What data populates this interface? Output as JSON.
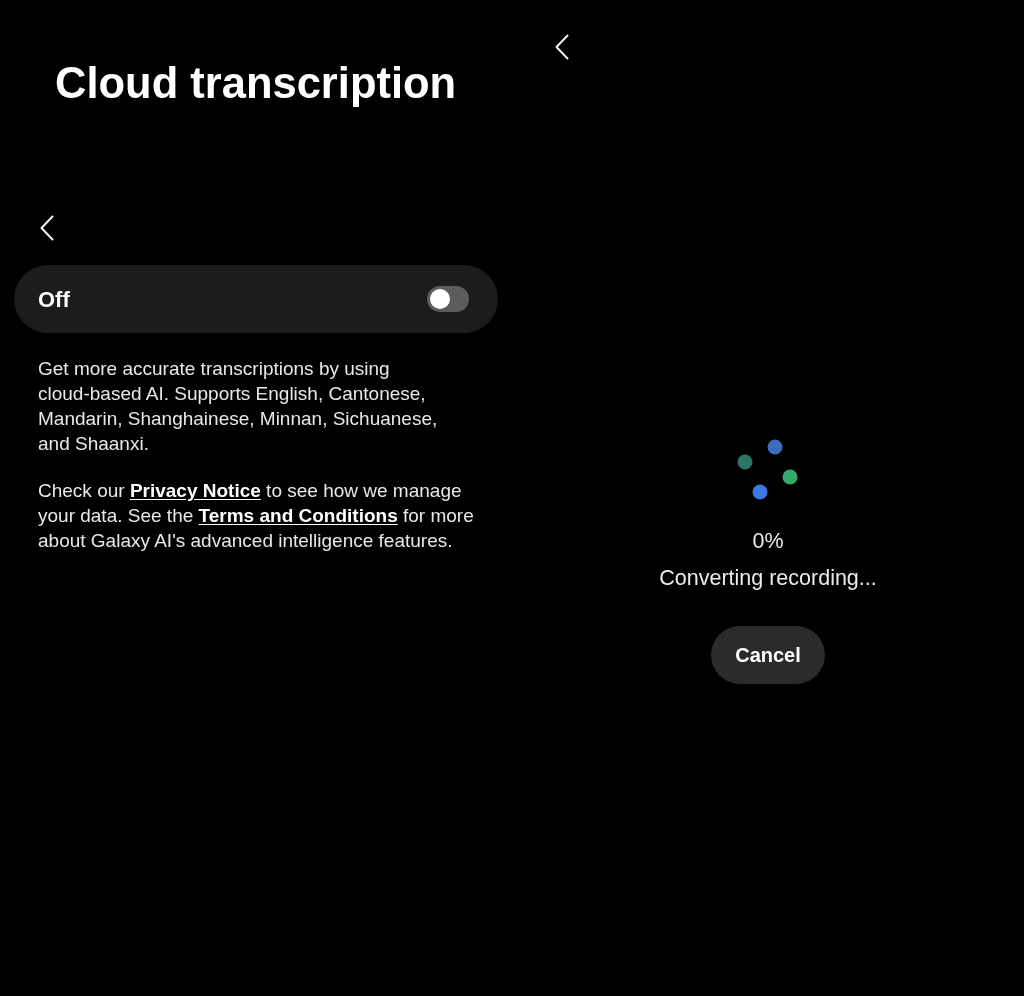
{
  "left_panel": {
    "title": "Cloud transcription",
    "setting": {
      "label": "Off",
      "on": false
    },
    "description": "Get more accurate transcriptions by using cloud-based AI. Supports English, Cantonese, Mandarin, Shanghainese, Minnan, Sichuanese, and Shaanxi.",
    "notice": [
      {
        "kind": "text",
        "text": "Check our "
      },
      {
        "kind": "link",
        "text": "Privacy Notice"
      },
      {
        "kind": "text",
        "text": " to see how we manage your data. See the "
      },
      {
        "kind": "link",
        "text": "Terms and Conditions"
      },
      {
        "kind": "text",
        "text": " for more about Galaxy AI's advanced intelligence features."
      }
    ]
  },
  "right_panel": {
    "progress": "0%",
    "status": "Converting recording...",
    "button": "Cancel"
  }
}
